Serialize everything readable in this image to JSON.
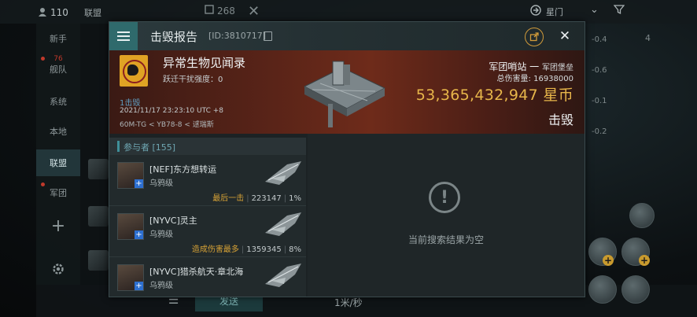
{
  "topbar": {
    "count": "110",
    "channel": "联盟",
    "num": "268",
    "gate": "星门"
  },
  "leftnav": {
    "items": [
      {
        "label": "新手"
      },
      {
        "label": "舰队",
        "badge": "76"
      },
      {
        "label": "系统"
      },
      {
        "label": "本地"
      },
      {
        "label": "联盟"
      },
      {
        "label": "军团"
      }
    ]
  },
  "bottombar": {
    "send": "发送",
    "speed": "1米/秒"
  },
  "right_side": {
    "values": [
      "-0.4",
      "-0.6",
      "-0.1",
      "-0.2"
    ],
    "count": "4"
  },
  "dialog": {
    "title": "击毁报告",
    "id": "[ID:3810717]",
    "victim": {
      "name": "异常生物见闻录",
      "jam": "跃迁干扰强度：0",
      "kills": "1击毁",
      "date": "2021/11/17 23:23:10 UTC +8",
      "location": "60M-TG < YB78-8 < 逑瑞斯",
      "type": "军团哨站 一",
      "type_sub": "军团堡垒",
      "damage": "总伤害量: 16938000",
      "isk_value": "53,365,432,947",
      "isk_unit": "星币",
      "status": "击毁"
    },
    "participants": {
      "header": "参与者 [155]",
      "rows": [
        {
          "name": "[NEF]东方想转运",
          "ship": "乌鸦级",
          "tag": "最后一击",
          "damage": "223147",
          "pct": "1%"
        },
        {
          "name": "[NYVC]灵主",
          "ship": "乌鸦级",
          "tag": "造成伤害最多",
          "damage": "1359345",
          "pct": "8%"
        },
        {
          "name": "[NYVC]猎杀航天·章北海",
          "ship": "乌鸦级",
          "tag": "",
          "damage": "",
          "pct": ""
        }
      ]
    },
    "empty_text": "当前搜索结果为空"
  }
}
